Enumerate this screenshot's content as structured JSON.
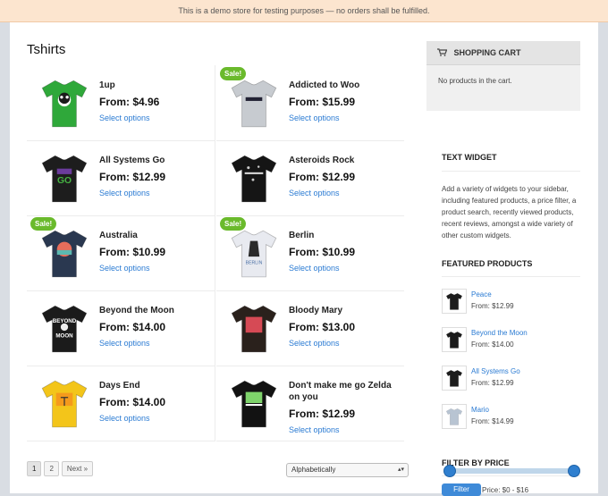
{
  "demo_notice": "This is a demo store for testing purposes — no orders shall be fulfilled.",
  "page_title": "Tshirts",
  "sale_badge": "Sale!",
  "products": [
    {
      "name": "1up",
      "price": "From: $4.96",
      "link": "Select options",
      "sale": false,
      "shirt_color": "#2fa83a",
      "print": "mushroom"
    },
    {
      "name": "Addicted to Woo",
      "price": "From: $15.99",
      "link": "Select options",
      "sale": true,
      "shirt_color": "#c7cbd0",
      "print": "woo"
    },
    {
      "name": "All Systems Go",
      "price": "From: $12.99",
      "link": "Select options",
      "sale": false,
      "shirt_color": "#1d1d1d",
      "print": "go"
    },
    {
      "name": "Asteroids Rock",
      "price": "From: $12.99",
      "link": "Select options",
      "sale": false,
      "shirt_color": "#151515",
      "print": "asteroids"
    },
    {
      "name": "Australia",
      "price": "From: $10.99",
      "link": "Select options",
      "sale": true,
      "shirt_color": "#2a3850",
      "print": "sunset"
    },
    {
      "name": "Berlin",
      "price": "From: $10.99",
      "link": "Select options",
      "sale": true,
      "shirt_color": "#e8eaf0",
      "print": "bear"
    },
    {
      "name": "Beyond the Moon",
      "price": "From: $14.00",
      "link": "Select options",
      "sale": false,
      "shirt_color": "#1b1b1b",
      "print": "moon"
    },
    {
      "name": "Bloody Mary",
      "price": "From: $13.00",
      "link": "Select options",
      "sale": false,
      "shirt_color": "#2a211c",
      "print": "mary"
    },
    {
      "name": "Days End",
      "price": "From: $14.00",
      "link": "Select options",
      "sale": false,
      "shirt_color": "#f3c51a",
      "print": "tree"
    },
    {
      "name": "Don't make me go Zelda on you",
      "price": "From: $12.99",
      "link": "Select options",
      "sale": false,
      "shirt_color": "#121212",
      "print": "zelda"
    }
  ],
  "pagination": {
    "page_1": "1",
    "page_2": "2",
    "next": "Next »"
  },
  "sort": {
    "selected": "Alphabetically",
    "arrows": "▴▾"
  },
  "cart": {
    "title": "SHOPPING CART",
    "icon": "cart-icon",
    "empty": "No products in the cart."
  },
  "text_widget": {
    "title": "TEXT WIDGET",
    "body": "Add a variety of widgets to your sidebar, including featured products, a price filter, a product search, recently viewed products, recent reviews, amongst a wide variety of other custom widgets."
  },
  "featured": {
    "title": "FEATURED PRODUCTS",
    "items": [
      {
        "name": "Peace",
        "price": "From: $12.99",
        "shirt_color": "#1d1d1d"
      },
      {
        "name": "Beyond the Moon",
        "price": "From: $14.00",
        "shirt_color": "#1b1b1b"
      },
      {
        "name": "All Systems Go",
        "price": "From: $12.99",
        "shirt_color": "#1d1d1d"
      },
      {
        "name": "Mario",
        "price": "From: $14.99",
        "shirt_color": "#b8c4d2"
      }
    ]
  },
  "filter": {
    "title": "FILTER BY PRICE",
    "button": "Filter",
    "range": "Price: $0 - $16"
  },
  "colors": {
    "link": "#2b7bd3",
    "sale": "#6aba2c",
    "accent": "#2f7fcf"
  }
}
